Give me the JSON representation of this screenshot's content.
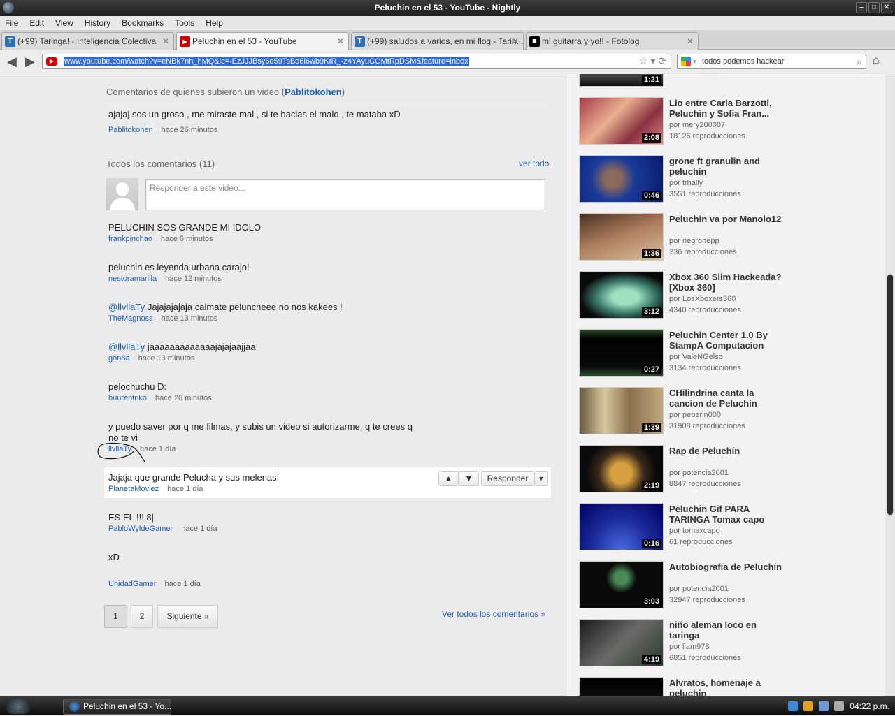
{
  "window": {
    "title": "Peluchin en el 53 - YouTube - Nightly"
  },
  "menu": [
    "File",
    "Edit",
    "View",
    "History",
    "Bookmarks",
    "Tools",
    "Help"
  ],
  "tabs": [
    {
      "label": "(+99) Taringa! - Inteligencia Colectiva",
      "icon": "T"
    },
    {
      "label": "Peluchin en el 53 - YouTube",
      "icon": "▶"
    },
    {
      "label": "(+99) saludos a varios, en mi flog - Tarin...",
      "icon": "T"
    },
    {
      "label": "mi guitarra y yo!! - Fotolog",
      "icon": "■"
    }
  ],
  "newtab": "+",
  "nav": {
    "url": "www.youtube.com/watch?v=eNBk7nh_hMQ&lc=-EzJJJBsy6d59TsBo6i6wb9KIR_-z4YAyuCOMtRpDSM&feature=inbox",
    "search": "todos podemos hackear"
  },
  "uploader_section": {
    "title_prefix": "Comentarios de quienes subieron un video (",
    "uploader": "Pablitokohen",
    "title_suffix": ")",
    "comment": {
      "text": "ajajaj sos un groso , me miraste mal , si te hacias el malo , te mataba xD",
      "author": "Pablitokohen",
      "time": "hace 26 minutos"
    }
  },
  "all_section": {
    "title": "Todos los comentarios (11)",
    "see_all": "ver todo",
    "reply_placeholder": "Responder a este video...",
    "comments": [
      {
        "text": "PELUCHIN SOS GRANDE MI IDOLO",
        "author": "frankpinchao",
        "time": "hace 6 minutos"
      },
      {
        "text": "peluchin es leyenda urbana carajo!",
        "author": "nestoramarilla",
        "time": "hace 12 minutos"
      },
      {
        "mention": "@llvllaTy",
        "text": " Jajajajajaja calmate peluncheee no nos kakees !",
        "author": "TheMagnoss",
        "time": "hace 13 minutos"
      },
      {
        "mention": "@llvllaTy",
        "text": " jaaaaaaaaaaaaajajajaajjaa",
        "author": "gon8a",
        "time": "hace 13 minutos"
      },
      {
        "text": "pelochuchu D:",
        "author": "buurentriko",
        "time": "hace 20 minutos"
      },
      {
        "text": "y puedo saver por q me filmas, y subis un video si autorizarme, q te crees q no te vi",
        "author": "llvllaTy",
        "time": "hace 1 día"
      },
      {
        "text": "Jajaja que grande Pelucha y sus melenas!",
        "author": "PlanetaMoviez",
        "time": "hace 1 día"
      },
      {
        "text": "ES EL !!! 8|",
        "author": "PabloWyldeGamer",
        "time": "hace 1 día"
      },
      {
        "text": "xD",
        "author": "UnidadGamer",
        "time": "hace 1 día"
      }
    ],
    "reply_button": "Responder",
    "pagination": {
      "pages": [
        "1",
        "2"
      ],
      "next": "Siguiente »",
      "view_all": "Ver todos los comentarios »"
    }
  },
  "related": {
    "top_partial": {
      "duration": "1:21"
    },
    "videos": [
      {
        "title": "Lio entre Carla Barzotti, Peluchin y Sofia Fran...",
        "by": "por mery200007",
        "views": "18126 reproducciones",
        "duration": "2:08"
      },
      {
        "title": "grone ft granulin and peluchin",
        "by": "por trhally",
        "views": "3551 reproducciones",
        "duration": "0:46"
      },
      {
        "title": "Peluchin va por Manolo12",
        "by": "por negrohepp",
        "views": "236 reproducciones",
        "duration": "1:36"
      },
      {
        "title": "Xbox 360 Slim Hackeada? [Xbox 360]",
        "by": "por LosXboxers360",
        "views": "4340 reproducciones",
        "duration": "3:12"
      },
      {
        "title": "Peluchin Center 1.0 By StampA Computacion",
        "by": "por ValeNGelso",
        "views": "3134 reproducciones",
        "duration": "0:27"
      },
      {
        "title": "CHilindrina canta la cancion de Peluchin",
        "by": "por peperin000",
        "views": "31908 reproducciones",
        "duration": "1:39"
      },
      {
        "title": "Rap de Peluchín",
        "by": "por potencia2001",
        "views": "8847 reproducciones",
        "duration": "2:19"
      },
      {
        "title": "Peluchin Gif PARA TARINGA Tomax  capo",
        "by": "por tomaxcapo",
        "views": "61 reproducciones",
        "duration": "0:16"
      },
      {
        "title": "Autobiografía de Peluchín",
        "by": "por potencia2001",
        "views": "32947 reproducciones",
        "duration": "3:03"
      },
      {
        "title": "niño aleman loco en taringa",
        "by": "por liam978",
        "views": "6851 reproducciones",
        "duration": "4:19"
      },
      {
        "title": "Alvratos, homenaje a peluchin",
        "by": "",
        "views": "",
        "duration": ""
      }
    ]
  },
  "taskbar": {
    "task": "Peluchin en el 53 - Yo...",
    "clock": "04:22 p.m."
  },
  "colors": {
    "link": "#1c62b9",
    "url_highlight": "#3168d5",
    "taringa": "#2f6fba",
    "youtube": "#d00000"
  }
}
